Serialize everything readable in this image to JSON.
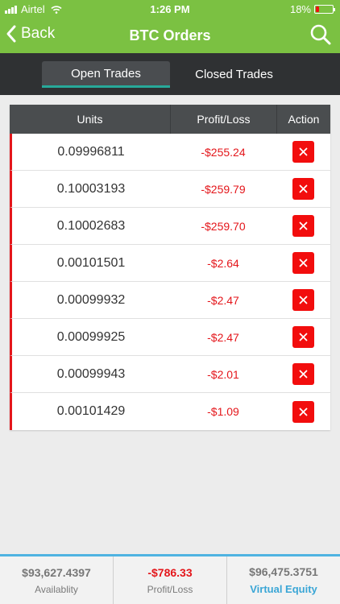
{
  "status_bar": {
    "carrier": "Airtel",
    "time": "1:26 PM",
    "battery": "18%",
    "battery_level": 0.18
  },
  "nav": {
    "back_label": "Back",
    "title": "BTC Orders"
  },
  "tabs": [
    {
      "label": "Open Trades",
      "active": true
    },
    {
      "label": "Closed Trades",
      "active": false
    }
  ],
  "table": {
    "columns": [
      "Units",
      "Profit/Loss",
      "Action"
    ],
    "rows": [
      {
        "units": "0.09996811",
        "pl": "-$255.24"
      },
      {
        "units": "0.10003193",
        "pl": "-$259.79"
      },
      {
        "units": "0.10002683",
        "pl": "-$259.70"
      },
      {
        "units": "0.00101501",
        "pl": "-$2.64"
      },
      {
        "units": "0.00099932",
        "pl": "-$2.47"
      },
      {
        "units": "0.00099925",
        "pl": "-$2.47"
      },
      {
        "units": "0.00099943",
        "pl": "-$2.01"
      },
      {
        "units": "0.00101429",
        "pl": "-$1.09"
      }
    ]
  },
  "footer": {
    "availability": {
      "value": "$93,627.4397",
      "label": "Availablity"
    },
    "profit_loss": {
      "value": "-$786.33",
      "label": "Profit/Loss"
    },
    "equity": {
      "value": "$96,475.3751",
      "label": "Virtual Equity"
    }
  },
  "colors": {
    "header_green": "#7bc142",
    "loss_red": "#e4161b",
    "accent_blue": "#3aa6d6",
    "tab_underline": "#27a99a"
  }
}
